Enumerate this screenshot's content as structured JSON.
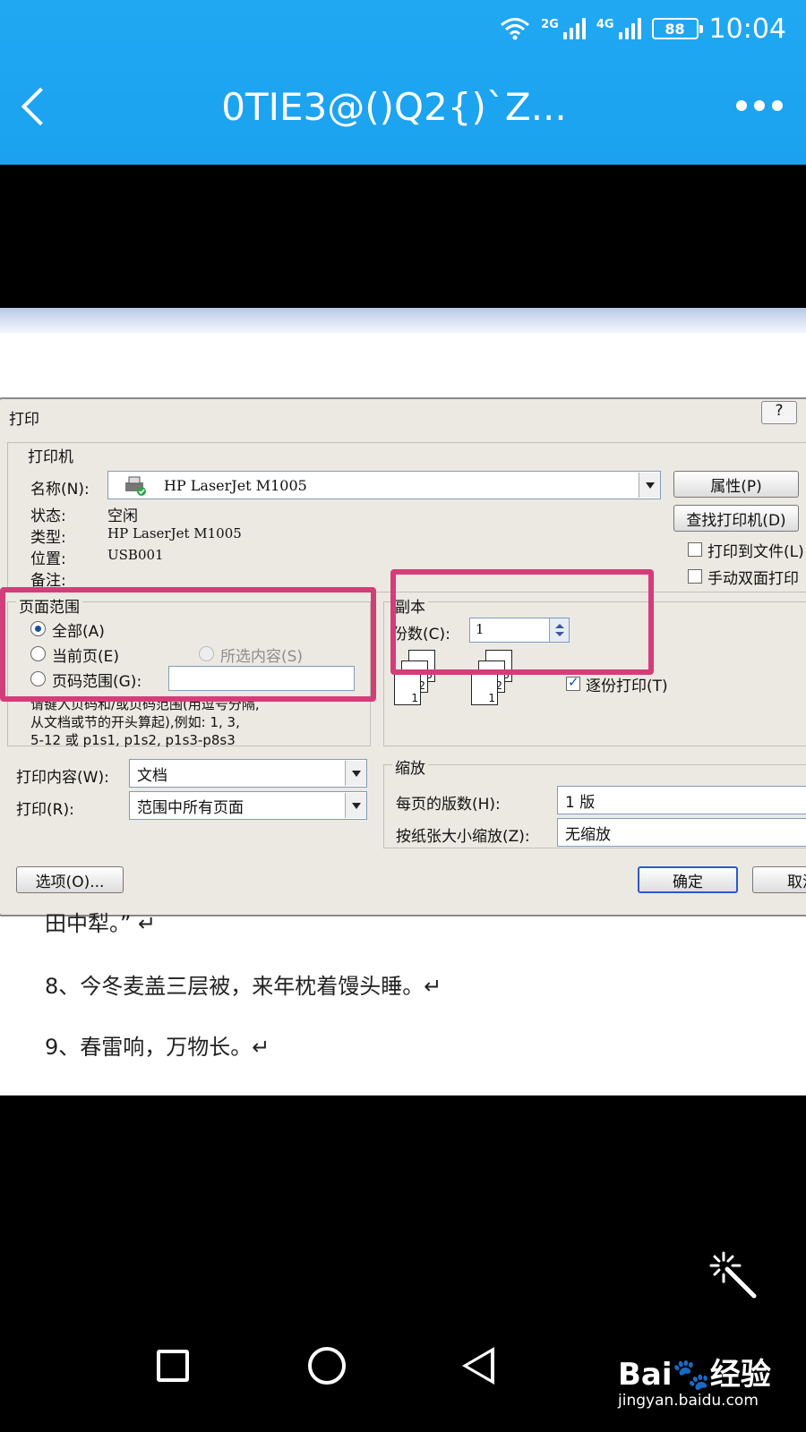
{
  "status_bar": {
    "net1": "2G",
    "net2": "4G",
    "battery": "88",
    "time": "10:04"
  },
  "app_bar": {
    "title": "0TIE3@()Q2{)`Z..."
  },
  "dialog": {
    "title": "打印",
    "help": "?",
    "printer_group": "打印机",
    "name_label": "名称(N):",
    "printer_name": "HP LaserJet M1005",
    "properties_btn": "属性(P)",
    "find_printer_btn": "查找打印机(D)",
    "status_label": "状态:",
    "status_value": "空闲",
    "type_label": "类型:",
    "type_value": "HP LaserJet M1005",
    "where_label": "位置:",
    "where_value": "USB001",
    "comment_label": "备注:",
    "print_to_file": "打印到文件(L)",
    "manual_duplex": "手动双面打印",
    "page_range": {
      "title": "页面范围",
      "all": "全部(A)",
      "current": "当前页(E)",
      "selection": "所选内容(S)",
      "pages": "页码范围(G):",
      "hint1": "请键入页码和/或页码范围(用逗号分隔,",
      "hint2": "从文档或节的开头算起),例如: 1, 3,",
      "hint3": "5-12 或 p1s1, p1s2, p1s3-p8s3"
    },
    "copies": {
      "title": "副本",
      "count_label": "份数(C):",
      "count_value": "1",
      "collate": "逐份打印(T)",
      "page_nums": [
        "1",
        "2",
        "3"
      ]
    },
    "print_what_label": "打印内容(W):",
    "print_what_value": "文档",
    "print_label": "打印(R):",
    "print_value": "范围中所有页面",
    "zoom": {
      "title": "缩放",
      "pages_per_sheet_label": "每页的版数(H):",
      "pages_per_sheet_value": "1 版",
      "scale_label": "按纸张大小缩放(Z):",
      "scale_value": "无缩放"
    },
    "options_btn": "选项(O)...",
    "ok_btn": "确定",
    "cancel_btn": "取消"
  },
  "doc_lines": [
    "田中犁。” ↵",
    "8、今冬麦盖三层被，来年枕着馒头睡。↵",
    "9、春雷响，万物长。↵"
  ],
  "watermark": {
    "brand": "Bai",
    "brand2": "经验",
    "url": "jingyan.baidu.com"
  },
  "colors": {
    "app_bar": "#1aa2f0",
    "highlight": "#d43d78"
  }
}
